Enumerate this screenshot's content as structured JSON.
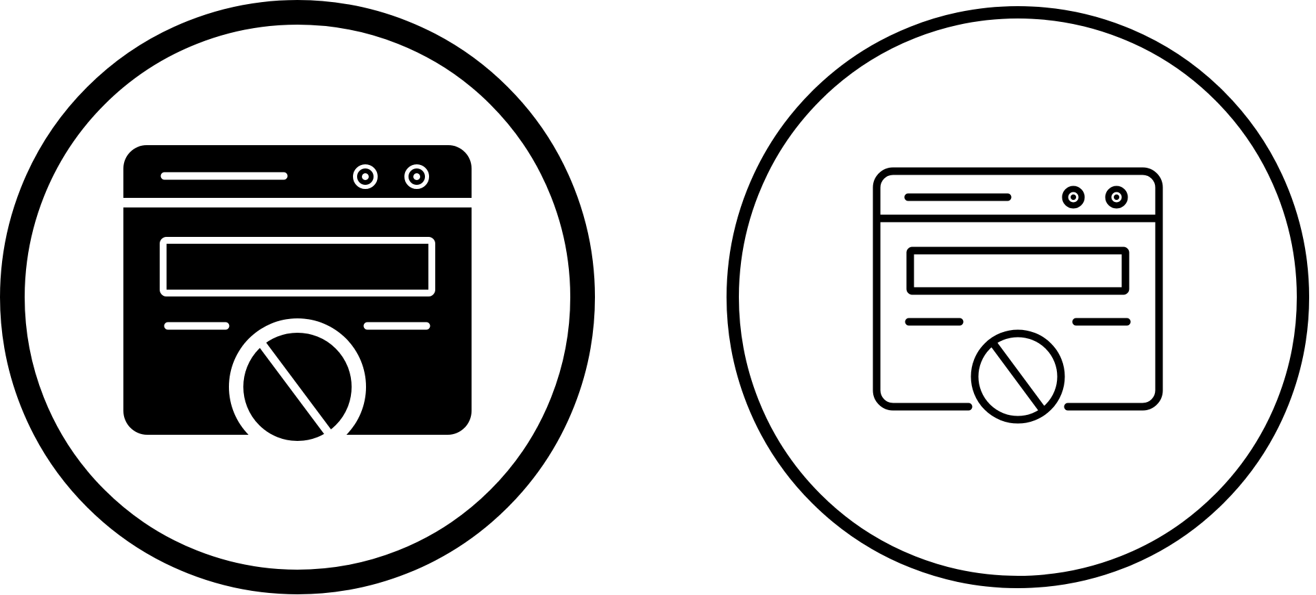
{
  "icons": [
    {
      "id": "blocked-webpage-glyph",
      "style": "glyph",
      "icon": "blocked-browser-window-icon"
    },
    {
      "id": "blocked-webpage-outline",
      "style": "outline",
      "icon": "blocked-browser-window-icon"
    }
  ],
  "colors": {
    "background": "#ffffff",
    "ink": "#000000"
  }
}
